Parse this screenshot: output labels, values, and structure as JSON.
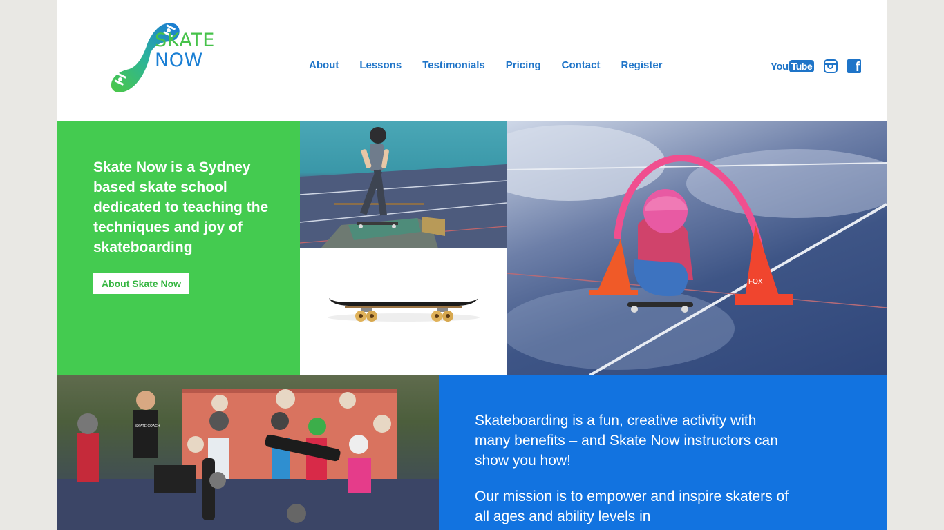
{
  "logo": {
    "line1": "SKATE",
    "line2": "NOW"
  },
  "nav": {
    "items": [
      "About",
      "Lessons",
      "Testimonials",
      "Pricing",
      "Contact",
      "Register"
    ]
  },
  "social": {
    "youtube_you": "You",
    "youtube_tube": "Tube",
    "facebook_letter": "f"
  },
  "hero": {
    "intro": "Skate Now is a Sydney based skate school dedicated to teaching the techniques and joy of skateboarding",
    "button_label": "About Skate Now"
  },
  "photos": {
    "cone_text": "FOX",
    "shirt_text": "SKATE COACH"
  },
  "about": {
    "paragraph1": "Skateboarding is a fun, creative activity with many benefits – and Skate Now instructors can show you how!",
    "paragraph2": "Our mission is to empower and inspire skaters of all ages and ability levels in"
  },
  "colors": {
    "brand_green": "#44cb50",
    "brand_blue": "#1273e0",
    "nav_blue": "#1e74c8",
    "page_background": "#e9e8e4"
  }
}
